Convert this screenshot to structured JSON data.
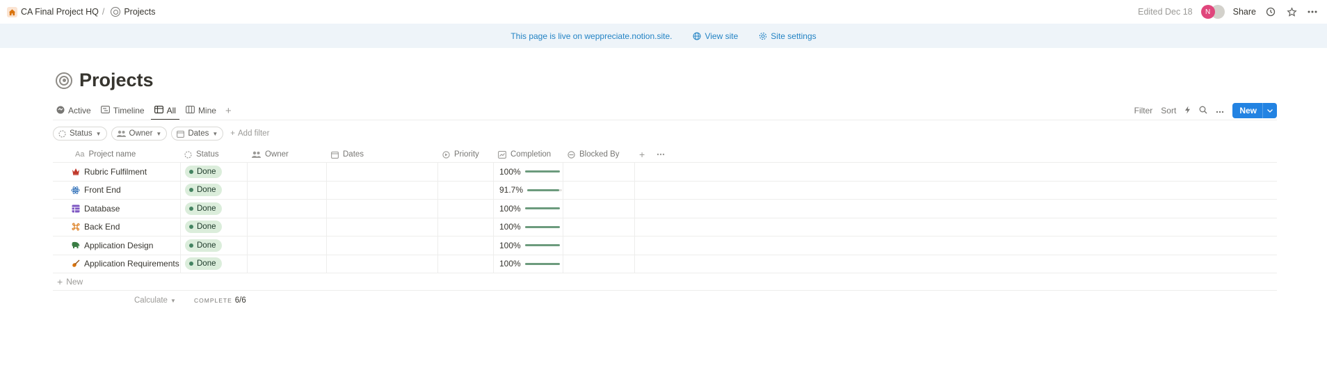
{
  "topbar": {
    "breadcrumb": [
      {
        "label": "CA Final Project HQ",
        "icon": "home-icon"
      },
      {
        "label": "Projects",
        "icon": "target-icon"
      }
    ],
    "separator": "/",
    "edited": "Edited Dec 18",
    "avatar_initial": "N",
    "share": "Share"
  },
  "banner": {
    "text": "This page is live on weppreciate.notion.site.",
    "view_site": "View site",
    "site_settings": "Site settings"
  },
  "page": {
    "title": "Projects",
    "views": [
      {
        "label": "Active",
        "icon": "active-icon"
      },
      {
        "label": "Timeline",
        "icon": "timeline-icon"
      },
      {
        "label": "All",
        "icon": "table-icon",
        "active": true
      },
      {
        "label": "Mine",
        "icon": "board-icon"
      }
    ],
    "toolbar": {
      "filter": "Filter",
      "sort": "Sort",
      "new": "New"
    },
    "filters": [
      "Status",
      "Owner",
      "Dates"
    ],
    "add_filter": "Add filter"
  },
  "table": {
    "columns": {
      "name": "Project name",
      "status": "Status",
      "owner": "Owner",
      "dates": "Dates",
      "priority": "Priority",
      "completion": "Completion",
      "blocked_by": "Blocked By"
    },
    "name_prefix": "Aa",
    "rows": [
      {
        "name": "Rubric Fulfilment",
        "icon": "crown-icon",
        "status": "Done",
        "completion": "100%",
        "completion_fraction": 1.0
      },
      {
        "name": "Front End",
        "icon": "atom-icon",
        "status": "Done",
        "completion": "91.7%",
        "completion_fraction": 0.917
      },
      {
        "name": "Database",
        "icon": "table-grid-icon",
        "status": "Done",
        "completion": "100%",
        "completion_fraction": 1.0
      },
      {
        "name": "Back End",
        "icon": "command-icon",
        "status": "Done",
        "completion": "100%",
        "completion_fraction": 1.0
      },
      {
        "name": "Application Design",
        "icon": "elephant-icon",
        "status": "Done",
        "completion": "100%",
        "completion_fraction": 1.0
      },
      {
        "name": "Application Requirements",
        "icon": "violin-icon",
        "status": "Done",
        "completion": "100%",
        "completion_fraction": 1.0
      }
    ],
    "new_row": "New",
    "calculate": "Calculate",
    "complete_label": "COMPLETE",
    "complete_value": "6/6"
  },
  "colors": {
    "accent": "#2383e2",
    "done_badge": "#dbeddb",
    "done_dot": "#448361",
    "progress": "#6c9b7d",
    "banner_bg": "#eef4f9",
    "avatar": "#e0467c"
  }
}
